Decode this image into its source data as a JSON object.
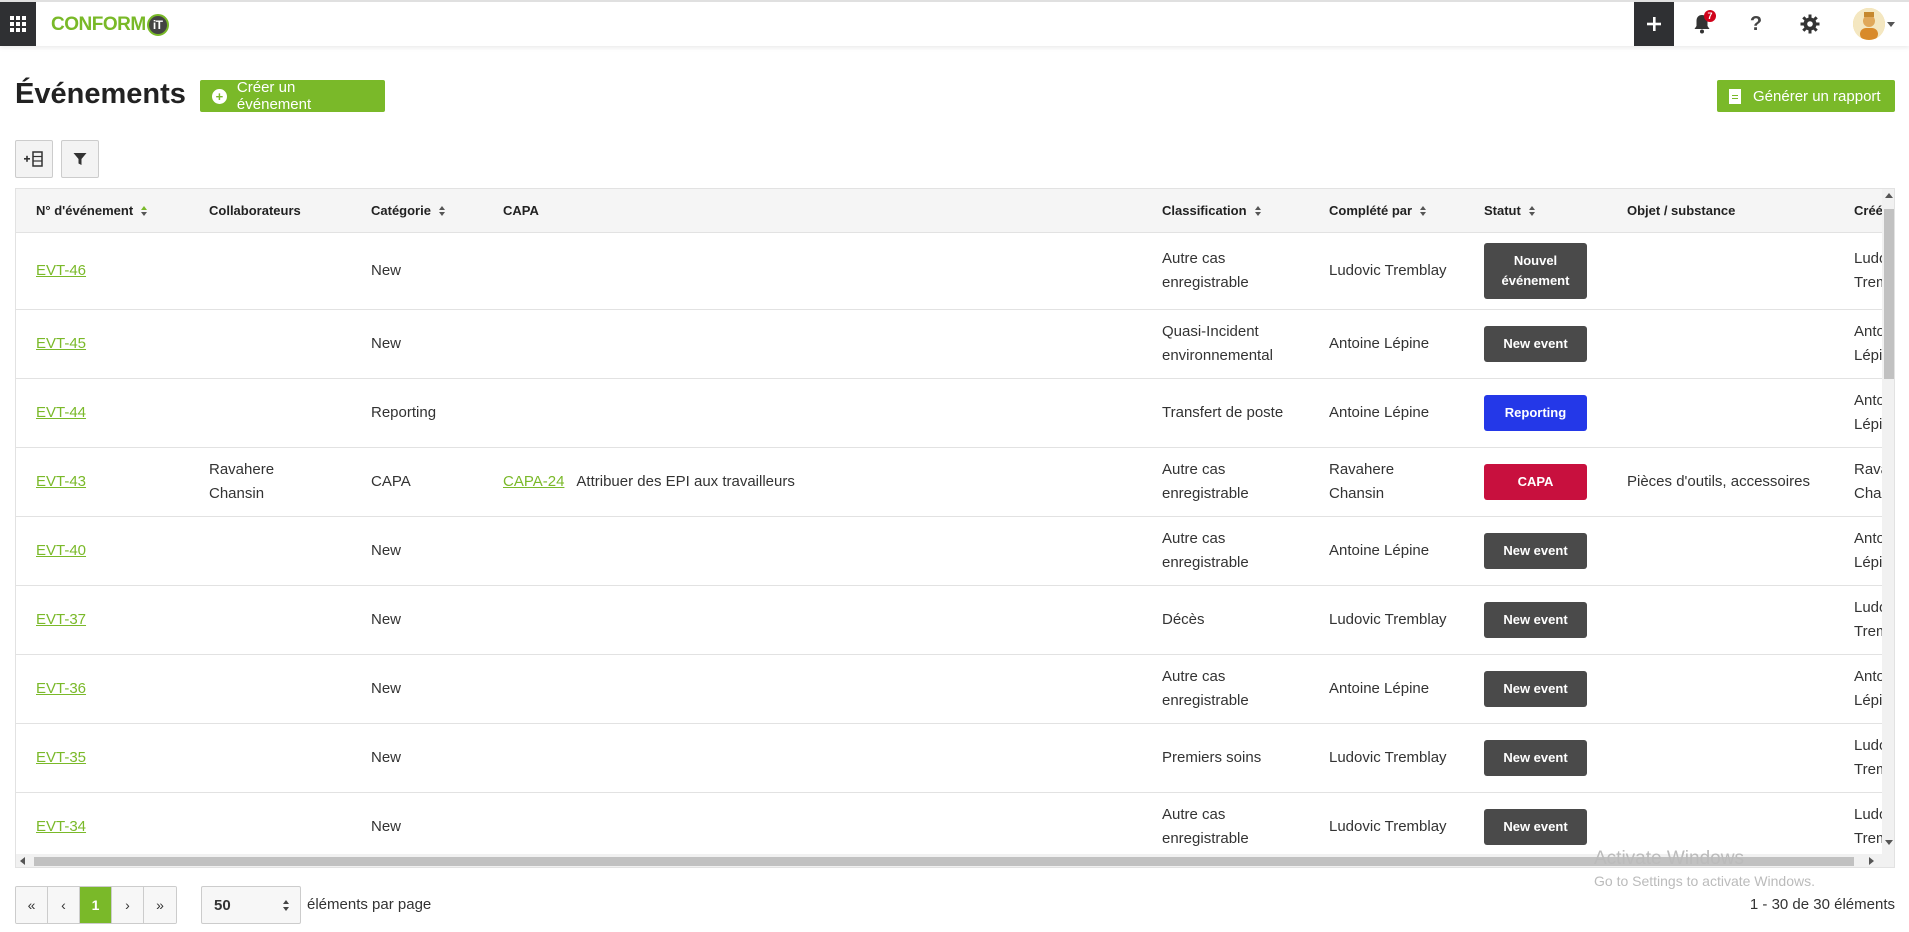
{
  "header": {
    "logo_text": "CONFORM",
    "logo_badge": "iT",
    "notification_count": "7",
    "help_glyph": "?"
  },
  "page": {
    "title": "Événements",
    "create_button": "Créer un événement",
    "report_button": "Générer un rapport"
  },
  "columns": {
    "event_no": "N° d'événement",
    "collaborators": "Collaborateurs",
    "category": "Catégorie",
    "capa": "CAPA",
    "classification": "Classification",
    "completed_by": "Complété par",
    "status": "Statut",
    "object": "Objet / substance",
    "created": "Créé"
  },
  "rows": [
    {
      "id": "EVT-46",
      "collaborators": "",
      "category": "New",
      "capa_id": "",
      "capa_text": "",
      "classification": "Autre cas enregistrable",
      "completed_by": "Ludovic Tremblay",
      "status": "Nouvel événement",
      "status_color": "#4a4a4a",
      "object": "",
      "created": "Ludovic Tremblay"
    },
    {
      "id": "EVT-45",
      "collaborators": "",
      "category": "New",
      "capa_id": "",
      "capa_text": "",
      "classification": "Quasi-Incident environnemental",
      "completed_by": "Antoine Lépine",
      "status": "New event",
      "status_color": "#4a4a4a",
      "object": "",
      "created": "Antoine Lépine"
    },
    {
      "id": "EVT-44",
      "collaborators": "",
      "category": "Reporting",
      "capa_id": "",
      "capa_text": "",
      "classification": "Transfert de poste",
      "completed_by": "Antoine Lépine",
      "status": "Reporting",
      "status_color": "#2438e8",
      "object": "",
      "created": "Antoine Lépine"
    },
    {
      "id": "EVT-43",
      "collaborators": "Ravahere Chansin",
      "category": "CAPA",
      "capa_id": "CAPA-24",
      "capa_text": "Attribuer des EPI aux travailleurs",
      "classification": "Autre cas enregistrable",
      "completed_by": "Ravahere Chansin",
      "status": "CAPA",
      "status_color": "#c8103e",
      "object": "Pièces d'outils, accessoires",
      "created": "Ravahere Chansin"
    },
    {
      "id": "EVT-40",
      "collaborators": "",
      "category": "New",
      "capa_id": "",
      "capa_text": "",
      "classification": "Autre cas enregistrable",
      "completed_by": "Antoine Lépine",
      "status": "New event",
      "status_color": "#4a4a4a",
      "object": "",
      "created": "Antoine Lépine"
    },
    {
      "id": "EVT-37",
      "collaborators": "",
      "category": "New",
      "capa_id": "",
      "capa_text": "",
      "classification": "Décès",
      "completed_by": "Ludovic Tremblay",
      "status": "New event",
      "status_color": "#4a4a4a",
      "object": "",
      "created": "Ludovic Tremblay"
    },
    {
      "id": "EVT-36",
      "collaborators": "",
      "category": "New",
      "capa_id": "",
      "capa_text": "",
      "classification": "Autre cas enregistrable",
      "completed_by": "Antoine Lépine",
      "status": "New event",
      "status_color": "#4a4a4a",
      "object": "",
      "created": "Antoine Lépine"
    },
    {
      "id": "EVT-35",
      "collaborators": "",
      "category": "New",
      "capa_id": "",
      "capa_text": "",
      "classification": "Premiers soins",
      "completed_by": "Ludovic Tremblay",
      "status": "New event",
      "status_color": "#4a4a4a",
      "object": "",
      "created": "Ludovic Tremblay"
    },
    {
      "id": "EVT-34",
      "collaborators": "",
      "category": "New",
      "capa_id": "",
      "capa_text": "",
      "classification": "Autre cas enregistrable",
      "completed_by": "Ludovic Tremblay",
      "status": "New event",
      "status_color": "#4a4a4a",
      "object": "",
      "created": "Ludovic Tremblay"
    }
  ],
  "pagination": {
    "first": "«",
    "prev": "‹",
    "current": "1",
    "next": "›",
    "last": "»",
    "per_page_value": "50",
    "per_page_label": "éléments par page",
    "count_text": "1 - 30 de 30 éléments"
  },
  "watermark": {
    "line1": "Activate Windows",
    "line2": "Go to Settings to activate Windows."
  },
  "icons": [
    "apps-grid-icon",
    "plus-icon",
    "bell-icon",
    "help-icon",
    "gear-icon",
    "add-column-icon",
    "filter-icon",
    "report-document-icon"
  ],
  "colors": {
    "brand_green": "#7ab929",
    "dark": "#2f3033"
  }
}
